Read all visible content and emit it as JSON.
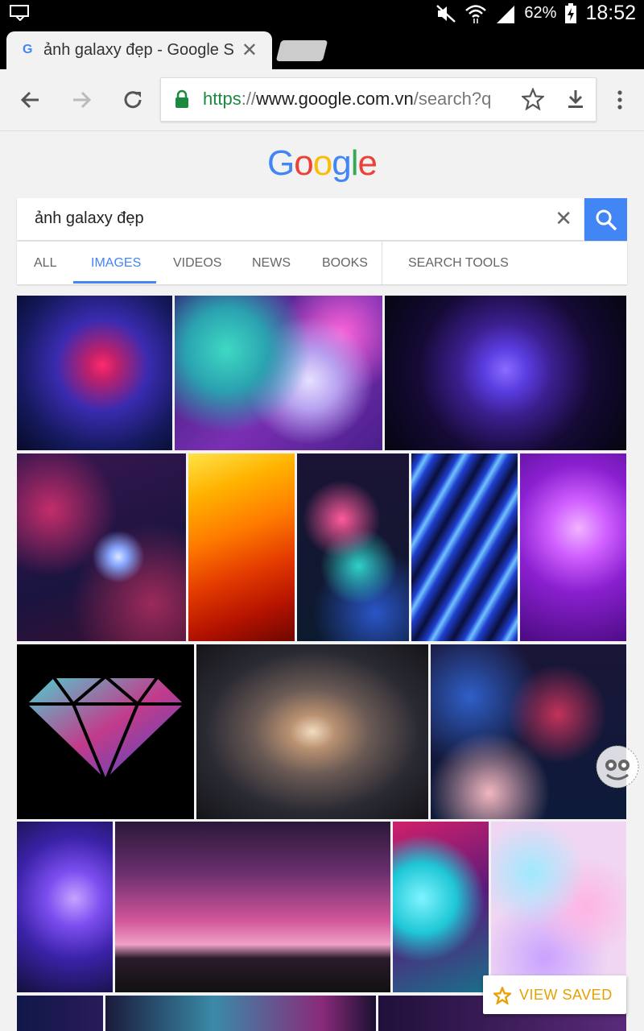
{
  "status_bar": {
    "battery_percent": "62%",
    "time": "18:52",
    "icons": [
      "notification-icon",
      "mute-icon",
      "wifi-icon",
      "signal-icon",
      "battery-charging-icon"
    ]
  },
  "browser": {
    "tab": {
      "title": "ảnh galaxy đẹp - Google S",
      "favicon": "G"
    },
    "omnibox": {
      "url_scheme": "https",
      "url_sep": "://",
      "url_host": "www.google.com.vn",
      "url_path": "/search?q"
    }
  },
  "search": {
    "logo_letters": [
      "G",
      "o",
      "o",
      "g",
      "l",
      "e"
    ],
    "logo_colors": [
      "#4285f4",
      "#ea4335",
      "#fbbc05",
      "#4285f4",
      "#34a853",
      "#ea4335"
    ],
    "query": "ảnh galaxy đẹp",
    "clear_icon": "✕",
    "tabs": [
      "ALL",
      "IMAGES",
      "VIDEOS",
      "NEWS",
      "BOOKS"
    ],
    "active_tab": "IMAGES",
    "tools_label": "SEARCH TOOLS"
  },
  "results": {
    "image_count_visible": 20
  },
  "fab": {
    "label": "VIEW SAVED"
  },
  "colors": {
    "accent": "#4285f4",
    "saved": "#e8a000"
  }
}
